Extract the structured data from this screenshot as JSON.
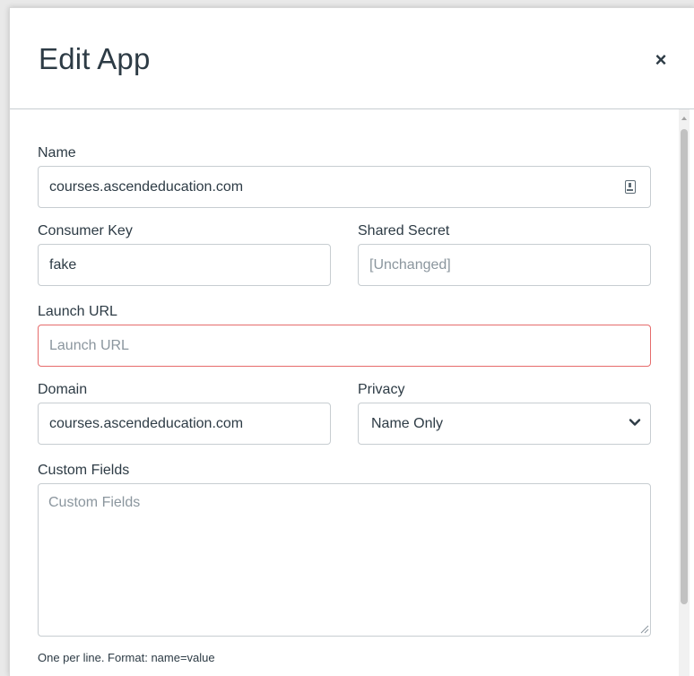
{
  "modal": {
    "title": "Edit App",
    "close_label": "×"
  },
  "form": {
    "name": {
      "label": "Name",
      "value": "courses.ascendeducation.com",
      "icon": "contact-card-icon"
    },
    "consumer_key": {
      "label": "Consumer Key",
      "value": "fake"
    },
    "shared_secret": {
      "label": "Shared Secret",
      "placeholder": "[Unchanged]"
    },
    "launch_url": {
      "label": "Launch URL",
      "placeholder": "Launch URL",
      "state": "error"
    },
    "domain": {
      "label": "Domain",
      "value": "courses.ascendeducation.com"
    },
    "privacy": {
      "label": "Privacy",
      "selected": "Name Only"
    },
    "custom_fields": {
      "label": "Custom Fields",
      "placeholder": "Custom Fields",
      "hint": "One per line. Format: name=value"
    }
  },
  "colors": {
    "text": "#2d3b45",
    "border": "#c7cdd1",
    "error_border": "#e66b6b",
    "placeholder": "#8b969e"
  }
}
